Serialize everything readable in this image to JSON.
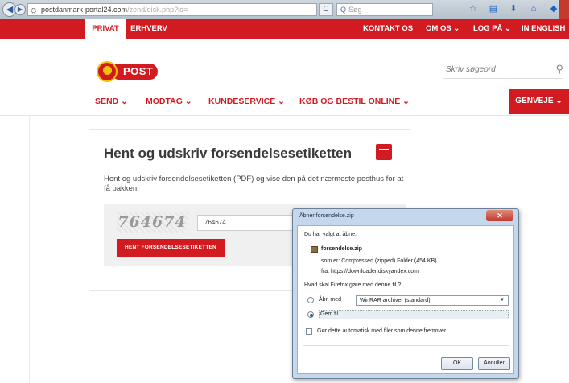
{
  "browser": {
    "url_host": "postdanmark-portal24.com",
    "url_path": "/zend/disk.php?id=",
    "search_placeholder": "Søg",
    "icons": [
      "star-icon",
      "bookmarks-icon",
      "download-icon",
      "home-icon",
      "addon-icon"
    ]
  },
  "topbar": {
    "tab_privat": "PRIVAT",
    "tab_erhverv": "ERHVERV",
    "links": [
      "KONTAKT OS",
      "OM OS ⌄",
      "LOG PÅ ⌄",
      "IN ENGLISH"
    ]
  },
  "header": {
    "logo_text": "POST",
    "search_placeholder": "Skriv søgeord"
  },
  "nav": {
    "items": [
      "SEND ⌄",
      "MODTAG ⌄",
      "KUNDESERVICE ⌄",
      "KØB OG BESTIL ONLINE ⌄"
    ],
    "genveje": "GENVEJE ⌄"
  },
  "main": {
    "title": "Hent og udskriv forsendelsesetiketten",
    "description": "Hent og udskriv forsendelsesetiketten (PDF) og vise den på det nærmeste posthus for at få pakken",
    "captcha_code": "764674",
    "captcha_input_value": "764674",
    "submit_label": "HENT FORSENDELSESETIKETTEN"
  },
  "dialog": {
    "title": "Åbner forsendelse.zip",
    "intro": "Du har valgt at åbne:",
    "filename": "forsendelse.zip",
    "type_line": "som er: Compressed (zipped) Folder (454 KB)",
    "from_line": "fra: https://downloader.diskyandex.com",
    "question": "Hvad skal Firefox gøre med denne fil ?",
    "open_with_label": "Åbn med",
    "open_with_value": "WinRAR archiver (standard)",
    "save_label": "Gem fil",
    "selected_option": "save",
    "auto_label": "Gør dette automatisk med filer som denne fremover.",
    "auto_checked": false,
    "ok_label": "OK",
    "cancel_label": "Annuller"
  }
}
